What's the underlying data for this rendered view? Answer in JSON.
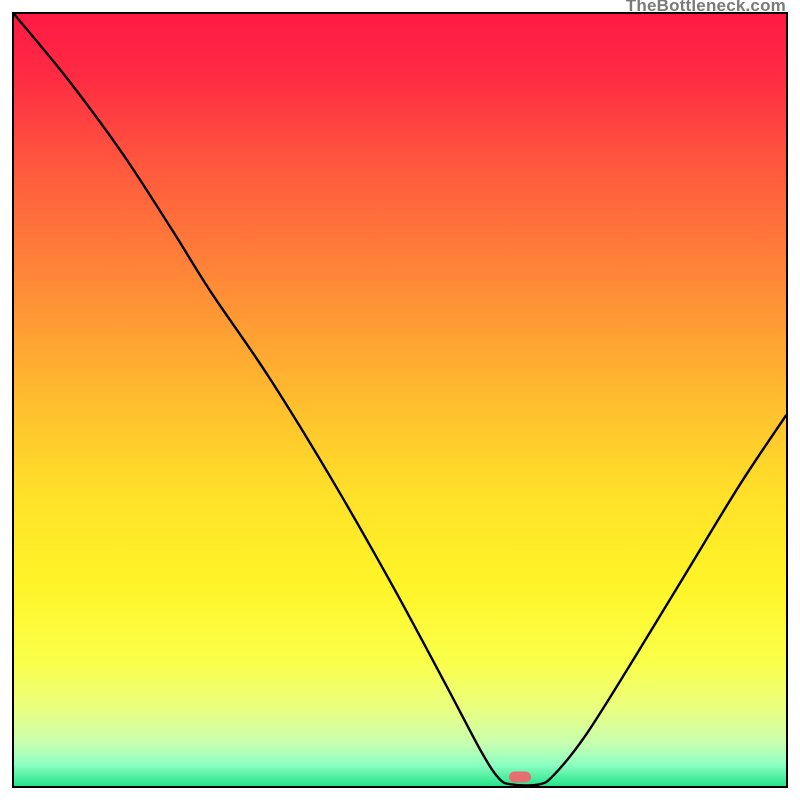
{
  "watermark": "TheBottleneck.com",
  "gradient_stops": [
    {
      "offset": 0.0,
      "color": "#ff1a44"
    },
    {
      "offset": 0.08,
      "color": "#ff2b43"
    },
    {
      "offset": 0.2,
      "color": "#ff593e"
    },
    {
      "offset": 0.35,
      "color": "#ff8a37"
    },
    {
      "offset": 0.5,
      "color": "#ffbd2e"
    },
    {
      "offset": 0.62,
      "color": "#ffe029"
    },
    {
      "offset": 0.74,
      "color": "#fff528"
    },
    {
      "offset": 0.84,
      "color": "#faff4a"
    },
    {
      "offset": 0.9,
      "color": "#eaff80"
    },
    {
      "offset": 0.945,
      "color": "#c7ffb0"
    },
    {
      "offset": 0.972,
      "color": "#8effc2"
    },
    {
      "offset": 1.0,
      "color": "#25e48a"
    }
  ],
  "marker": {
    "x_frac": 0.655,
    "y_frac": 0.988,
    "color": "#e36f72"
  },
  "chart_data": {
    "type": "line",
    "title": "",
    "xlabel": "",
    "ylabel": "",
    "xlim": [
      0,
      1
    ],
    "ylim": [
      0,
      1
    ],
    "series": [
      {
        "name": "bottleneck-curve",
        "points": [
          {
            "x": 0.0,
            "y": 1.0
          },
          {
            "x": 0.07,
            "y": 0.915
          },
          {
            "x": 0.14,
            "y": 0.82
          },
          {
            "x": 0.205,
            "y": 0.72
          },
          {
            "x": 0.255,
            "y": 0.64
          },
          {
            "x": 0.33,
            "y": 0.53
          },
          {
            "x": 0.41,
            "y": 0.4
          },
          {
            "x": 0.49,
            "y": 0.26
          },
          {
            "x": 0.56,
            "y": 0.13
          },
          {
            "x": 0.605,
            "y": 0.045
          },
          {
            "x": 0.628,
            "y": 0.01
          },
          {
            "x": 0.645,
            "y": 0.002
          },
          {
            "x": 0.68,
            "y": 0.002
          },
          {
            "x": 0.7,
            "y": 0.015
          },
          {
            "x": 0.74,
            "y": 0.065
          },
          {
            "x": 0.8,
            "y": 0.16
          },
          {
            "x": 0.87,
            "y": 0.275
          },
          {
            "x": 0.94,
            "y": 0.39
          },
          {
            "x": 1.0,
            "y": 0.48
          }
        ]
      }
    ],
    "optimal_marker_x": 0.655
  }
}
